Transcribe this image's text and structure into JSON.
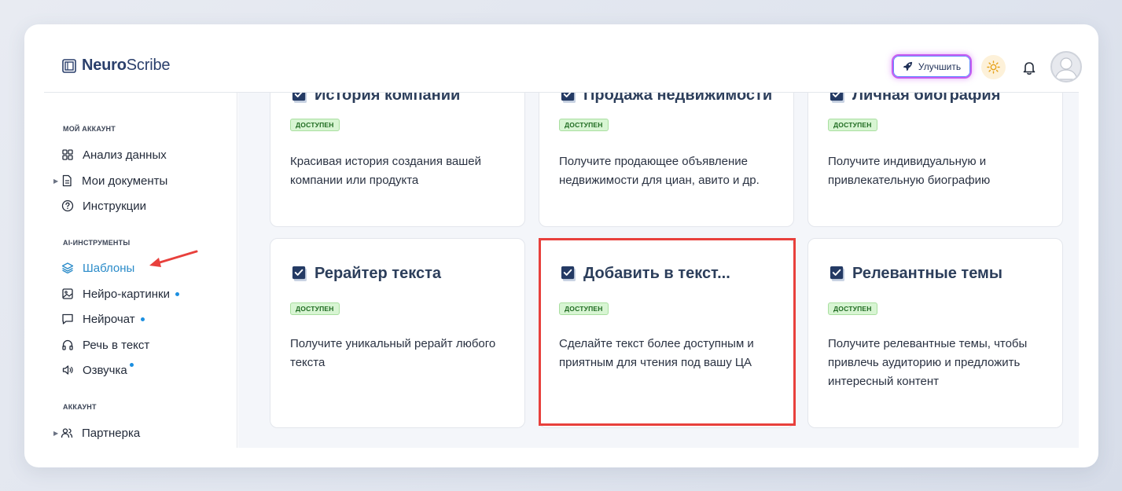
{
  "header": {
    "logo_bold": "Neuro",
    "logo_regular": "Scribe",
    "upgrade_label": "Улучшить"
  },
  "sidebar": {
    "sections": [
      {
        "title": "МОЙ АККАУНТ",
        "items": [
          {
            "label": "Анализ данных",
            "icon": "grid-icon"
          },
          {
            "label": "Мои документы",
            "icon": "document-icon",
            "expandable": true
          },
          {
            "label": "Инструкции",
            "icon": "help-circle-icon"
          }
        ]
      },
      {
        "title": "AI-ИНСТРУМЕНТЫ",
        "items": [
          {
            "label": "Шаблоны",
            "icon": "layers-icon",
            "active": true
          },
          {
            "label": "Нейро-картинки",
            "icon": "image-icon",
            "dot": true
          },
          {
            "label": "Нейрочат",
            "icon": "chat-icon",
            "dot": true
          },
          {
            "label": "Речь в текст",
            "icon": "headphones-icon"
          },
          {
            "label": "Озвучка",
            "icon": "speaker-icon",
            "dot": true
          }
        ]
      },
      {
        "title": "АККАУНТ",
        "items": [
          {
            "label": "Партнерка",
            "icon": "users-icon",
            "expandable": true
          }
        ]
      }
    ]
  },
  "cards": [
    {
      "title": "История компании",
      "badge": "ДОСТУПЕН",
      "desc": "Красивая история создания вашей компании или продукта"
    },
    {
      "title": "Продажа недвижимости",
      "badge": "ДОСТУПЕН",
      "desc": "Получите продающее объявление недвижимости для циан, авито и др."
    },
    {
      "title": "Личная биография",
      "badge": "ДОСТУПЕН",
      "desc": "Получите индивидуальную и привлекательную биографию"
    },
    {
      "title": "Рерайтер текста",
      "badge": "ДОСТУПЕН",
      "desc": "Получите уникальный рерайт любого текста"
    },
    {
      "title": "Добавить в текст...",
      "badge": "ДОСТУПЕН",
      "desc": "Сделайте текст более доступным и приятным для чтения под вашу ЦА",
      "highlighted": true
    },
    {
      "title": "Релевантные темы",
      "badge": "ДОСТУПЕН",
      "desc": "Получите релевантные темы, чтобы привлечь аудиторию и предложить интересный контент"
    }
  ],
  "colors": {
    "accent": "#2a8bc9",
    "badge_bg": "#d8f5d3",
    "highlight": "#e8403c",
    "annotation_arrow": "#e8403c"
  }
}
